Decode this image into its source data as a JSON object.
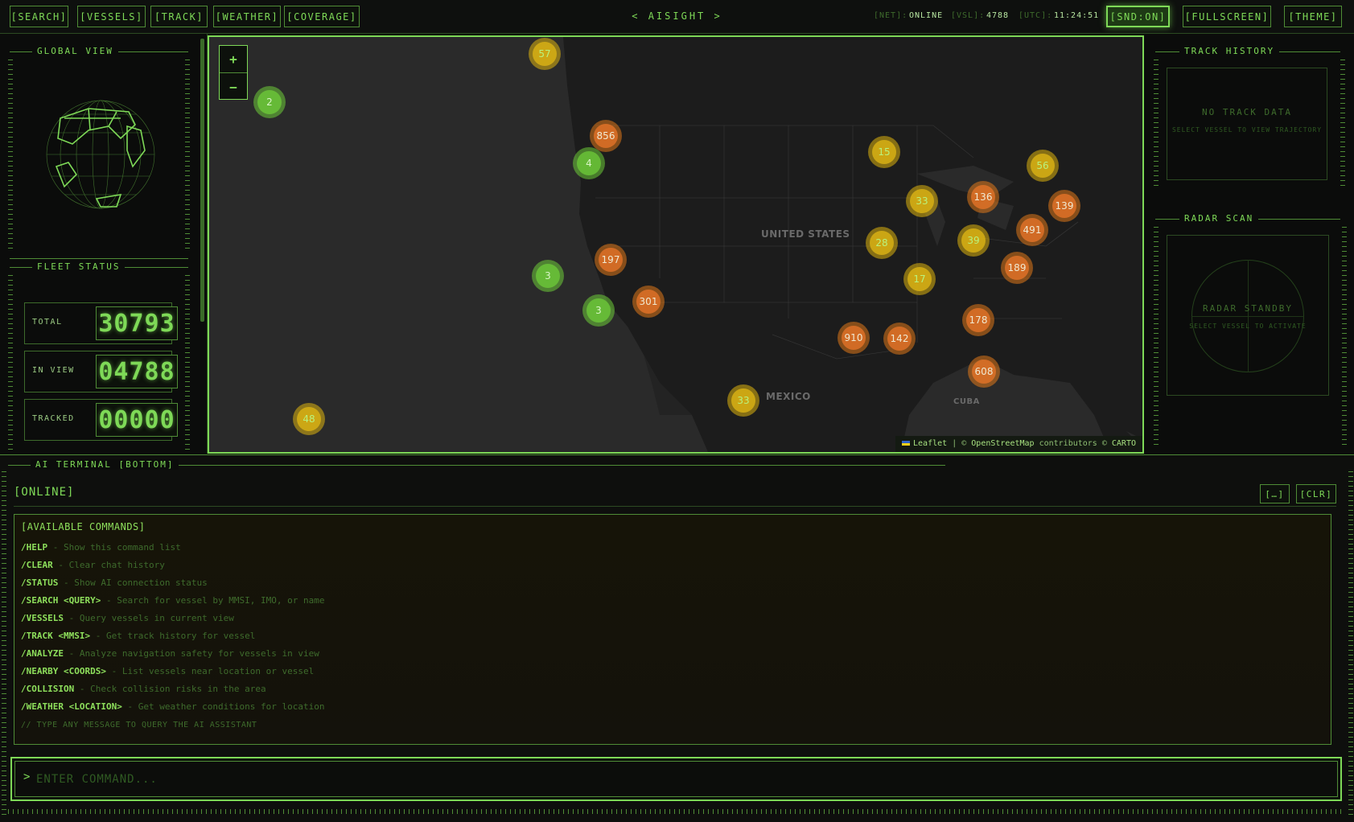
{
  "nav": {
    "search": "[SEARCH]",
    "vessels": "[VESSELS]",
    "track": "[TRACK]",
    "weather": "[WEATHER]",
    "coverage": "[COVERAGE]"
  },
  "brand": "< AISIGHT >",
  "status": {
    "net_key": "[NET]:",
    "net_val": "ONLINE",
    "vsl_key": "[VSL]:",
    "vsl_val": "4788",
    "utc_key": "[UTC]:",
    "utc_val": "11:24:51"
  },
  "controls": {
    "sound": "[SND:ON]",
    "fullscreen": "[FULLSCREEN]",
    "theme": "[THEME]"
  },
  "left": {
    "global_view_title": "GLOBAL VIEW",
    "fleet_status_title": "FLEET STATUS",
    "fleet": [
      {
        "label": "TOTAL",
        "value": "30793"
      },
      {
        "label": "IN VIEW",
        "value": "04788"
      },
      {
        "label": "TRACKED",
        "value": "00000"
      }
    ]
  },
  "map": {
    "zoom_in": "+",
    "zoom_out": "−",
    "labels": {
      "us": "UNITED STATES",
      "mexico": "MEXICO",
      "cuba": "CUBA"
    },
    "attribution": {
      "leaflet": "Leaflet",
      "sep": " | © ",
      "osm": "OpenStreetMap",
      "contrib": " contributors © ",
      "carto": "CARTO"
    },
    "clusters": [
      {
        "count": "57",
        "level": "yellow"
      },
      {
        "count": "2",
        "level": "green"
      },
      {
        "count": "856",
        "level": "orange"
      },
      {
        "count": "4",
        "level": "green"
      },
      {
        "count": "197",
        "level": "orange"
      },
      {
        "count": "3",
        "level": "green"
      },
      {
        "count": "3",
        "level": "green"
      },
      {
        "count": "301",
        "level": "orange"
      },
      {
        "count": "15",
        "level": "yellow"
      },
      {
        "count": "33",
        "level": "yellow"
      },
      {
        "count": "136",
        "level": "orange"
      },
      {
        "count": "56",
        "level": "yellow"
      },
      {
        "count": "139",
        "level": "orange"
      },
      {
        "count": "28",
        "level": "yellow"
      },
      {
        "count": "39",
        "level": "yellow"
      },
      {
        "count": "491",
        "level": "orange"
      },
      {
        "count": "17",
        "level": "yellow"
      },
      {
        "count": "189",
        "level": "orange"
      },
      {
        "count": "178",
        "level": "orange"
      },
      {
        "count": "910",
        "level": "orange"
      },
      {
        "count": "142",
        "level": "orange"
      },
      {
        "count": "608",
        "level": "orange"
      },
      {
        "count": "33",
        "level": "yellow"
      },
      {
        "count": "48",
        "level": "yellow"
      }
    ]
  },
  "right": {
    "track_history_title": "TRACK HISTORY",
    "no_track": "NO TRACK DATA",
    "no_track_sub": "SELECT VESSEL TO VIEW TRAJECTORY",
    "radar_title": "RADAR SCAN",
    "radar_standby": "RADAR STANDBY",
    "radar_sub": "SELECT VESSEL TO ACTIVATE"
  },
  "terminal": {
    "title": "AI TERMINAL [BOTTOM]",
    "status": "[ONLINE]",
    "btn_expand": "[…]",
    "btn_clear": "[CLR]",
    "header": "[AVAILABLE COMMANDS]",
    "commands": [
      {
        "cmd": "/HELP",
        "desc": "- Show this command list"
      },
      {
        "cmd": "/CLEAR",
        "desc": "- Clear chat history"
      },
      {
        "cmd": "/STATUS",
        "desc": "- Show AI connection status"
      },
      {
        "cmd": "/SEARCH <QUERY>",
        "desc": "- Search for vessel by MMSI, IMO, or name"
      },
      {
        "cmd": "/VESSELS",
        "desc": "- Query vessels in current view"
      },
      {
        "cmd": "/TRACK <MMSI>",
        "desc": "- Get track history for vessel"
      },
      {
        "cmd": "/ANALYZE",
        "desc": "- Analyze navigation safety for vessels in view"
      },
      {
        "cmd": "/NEARBY <COORDS>",
        "desc": "- List vessels near location or vessel"
      },
      {
        "cmd": "/COLLISION",
        "desc": "- Check collision risks in the area"
      },
      {
        "cmd": "/WEATHER <LOCATION>",
        "desc": "- Get weather conditions for location"
      }
    ],
    "hint": "// TYPE ANY MESSAGE TO QUERY THE AI ASSISTANT",
    "prompt": ">",
    "placeholder": "ENTER COMMAND..."
  }
}
